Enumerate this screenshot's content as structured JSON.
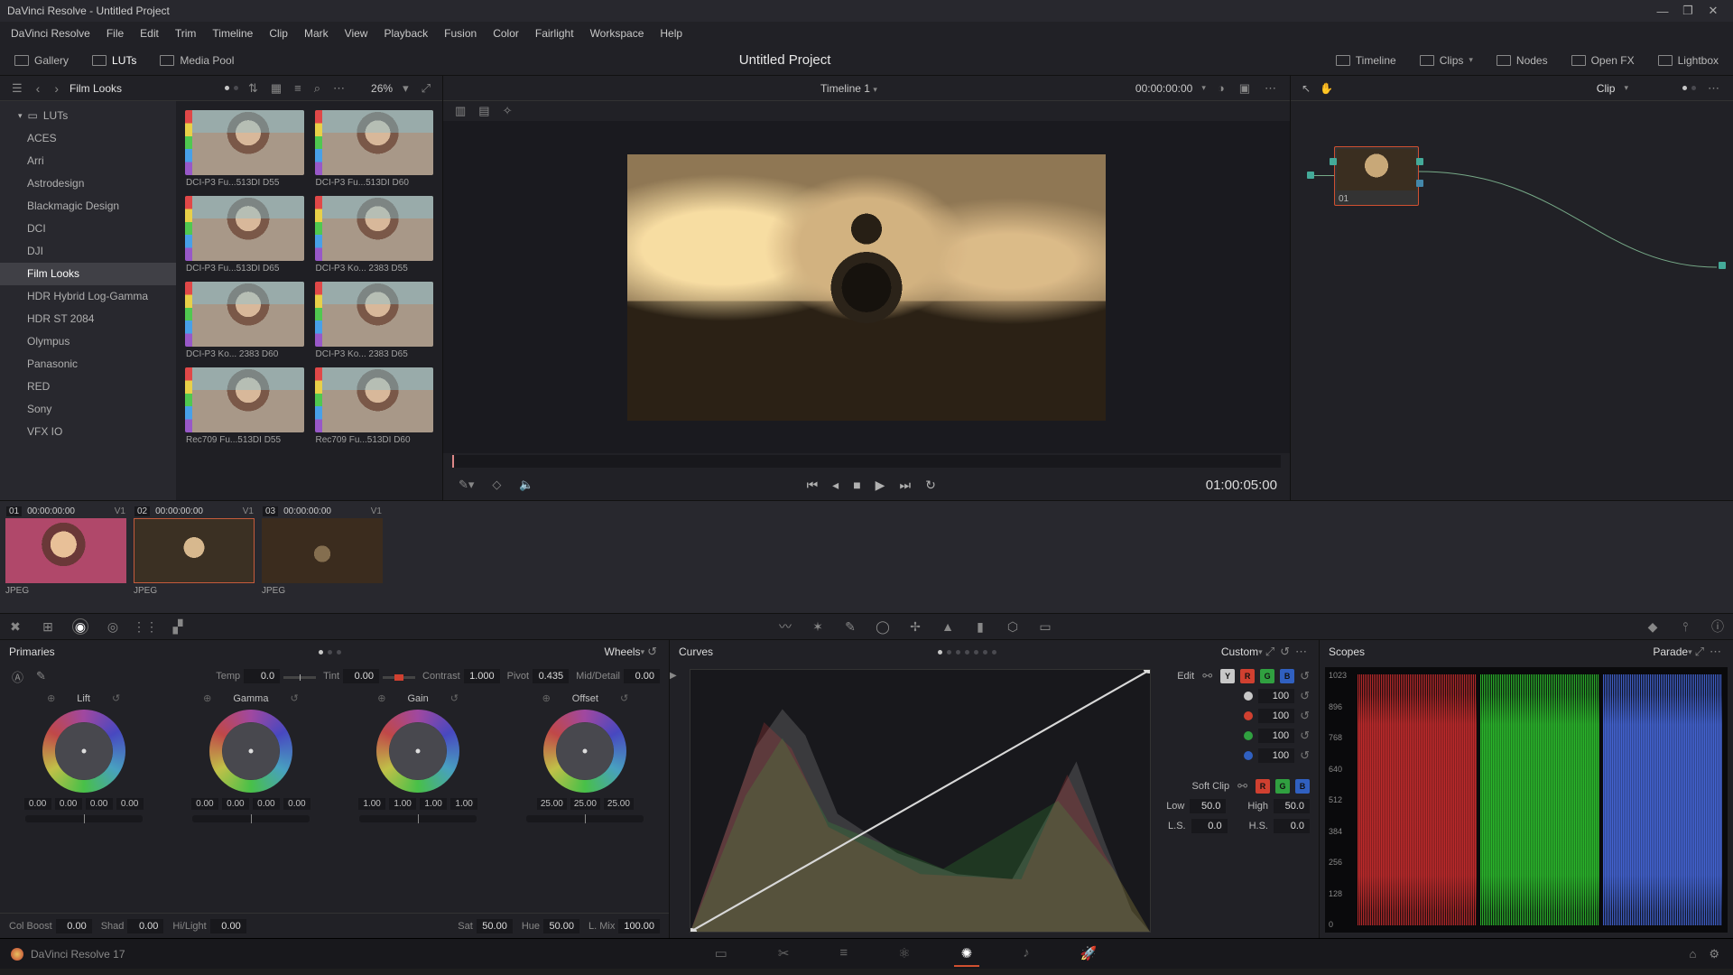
{
  "window": {
    "title": "DaVinci Resolve - Untitled Project",
    "min": "—",
    "max": "❐",
    "close": "✕"
  },
  "menubar": [
    "DaVinci Resolve",
    "File",
    "Edit",
    "Trim",
    "Timeline",
    "Clip",
    "Mark",
    "View",
    "Playback",
    "Fusion",
    "Color",
    "Fairlight",
    "Workspace",
    "Help"
  ],
  "toolbar_left": {
    "gallery": "Gallery",
    "luts": "LUTs",
    "mediapool": "Media Pool"
  },
  "project_title": "Untitled Project",
  "toolbar_right": {
    "timeline": "Timeline",
    "clips": "Clips",
    "nodes": "Nodes",
    "openfx": "Open FX",
    "lightbox": "Lightbox"
  },
  "film_looks": {
    "breadcrumb": "Film Looks",
    "zoom": "26%",
    "tree_root": "LUTs",
    "tree": [
      "ACES",
      "Arri",
      "Astrodesign",
      "Blackmagic Design",
      "DCI",
      "DJI",
      "Film Looks",
      "HDR Hybrid Log-Gamma",
      "HDR ST 2084",
      "Olympus",
      "Panasonic",
      "RED",
      "Sony",
      "VFX IO"
    ],
    "tree_selected": "Film Looks",
    "thumbs": [
      "DCI-P3 Fu...513DI D55",
      "DCI-P3 Fu...513DI D60",
      "DCI-P3 Fu...513DI D65",
      "DCI-P3 Ko... 2383 D55",
      "DCI-P3 Ko... 2383 D60",
      "DCI-P3 Ko... 2383 D65",
      "Rec709 Fu...513DI D55",
      "Rec709 Fu...513DI D60"
    ]
  },
  "viewer": {
    "timeline_name": "Timeline 1",
    "header_tc": "00:00:00:00",
    "play_tc": "01:00:05:00"
  },
  "nodes_panel": {
    "mode": "Clip",
    "node_label": "01"
  },
  "clips": [
    {
      "idx": "01",
      "tc": "00:00:00:00",
      "trk": "V1",
      "fmt": "JPEG"
    },
    {
      "idx": "02",
      "tc": "00:00:00:00",
      "trk": "V1",
      "fmt": "JPEG"
    },
    {
      "idx": "03",
      "tc": "00:00:00:00",
      "trk": "V1",
      "fmt": "JPEG"
    }
  ],
  "primaries": {
    "title": "Primaries",
    "mode": "Wheels",
    "top": {
      "temp_k": "Temp",
      "temp_v": "0.0",
      "tint_k": "Tint",
      "tint_v": "0.00",
      "contrast_k": "Contrast",
      "contrast_v": "1.000",
      "pivot_k": "Pivot",
      "pivot_v": "0.435",
      "md_k": "Mid/Detail",
      "md_v": "0.00"
    },
    "wheels": {
      "lift": {
        "label": "Lift",
        "vals": [
          "0.00",
          "0.00",
          "0.00",
          "0.00"
        ]
      },
      "gamma": {
        "label": "Gamma",
        "vals": [
          "0.00",
          "0.00",
          "0.00",
          "0.00"
        ]
      },
      "gain": {
        "label": "Gain",
        "vals": [
          "1.00",
          "1.00",
          "1.00",
          "1.00"
        ]
      },
      "offset": {
        "label": "Offset",
        "vals": [
          "25.00",
          "25.00",
          "25.00"
        ]
      }
    },
    "bot": {
      "colboost_k": "Col Boost",
      "colboost_v": "0.00",
      "shad_k": "Shad",
      "shad_v": "0.00",
      "hilight_k": "Hi/Light",
      "hilight_v": "0.00",
      "sat_k": "Sat",
      "sat_v": "50.00",
      "hue_k": "Hue",
      "hue_v": "50.00",
      "lmix_k": "L. Mix",
      "lmix_v": "100.00"
    }
  },
  "curves": {
    "title": "Curves",
    "mode": "Custom",
    "edit_label": "Edit",
    "softclip_label": "Soft Clip",
    "vals_y": "100",
    "vals_r": "100",
    "vals_g": "100",
    "vals_b": "100",
    "low_k": "Low",
    "low_v": "50.0",
    "high_k": "High",
    "high_v": "50.0",
    "ls_k": "L.S.",
    "ls_v": "0.0",
    "hs_k": "H.S.",
    "hs_v": "0.0"
  },
  "scopes": {
    "title": "Scopes",
    "mode": "Parade",
    "ticks": [
      "1023",
      "896",
      "768",
      "640",
      "512",
      "384",
      "256",
      "128",
      "0"
    ]
  },
  "footer": {
    "app": "DaVinci Resolve 17",
    "home": "⌂",
    "gear": "⚙"
  }
}
